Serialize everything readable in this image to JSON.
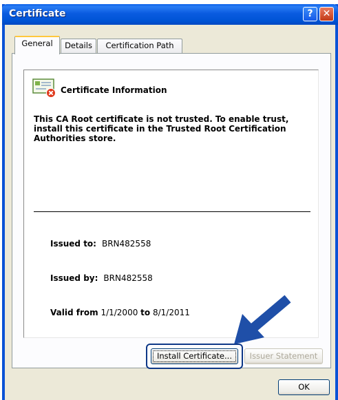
{
  "window": {
    "title": "Certificate",
    "help": "?",
    "close": "✕"
  },
  "tabs": [
    {
      "label": "General",
      "active": true
    },
    {
      "label": "Details",
      "active": false
    },
    {
      "label": "Certification Path",
      "active": false
    }
  ],
  "info": {
    "title": "Certificate Information",
    "warning": "This CA Root certificate is not trusted. To enable trust, install this certificate in the Trusted Root Certification Authorities store.",
    "issued_to_label": "Issued to:",
    "issued_to": "BRN482558",
    "issued_by_label": "Issued by:",
    "issued_by": "BRN482558",
    "valid_from_label": "Valid from",
    "valid_from": "1/1/2000",
    "to_label": "to",
    "valid_to": "8/1/2011"
  },
  "buttons": {
    "install": "Install Certificate...",
    "issuer_statement": "Issuer Statement",
    "ok": "OK"
  },
  "colors": {
    "title_bar": "#0054d6",
    "arrow": "#1f4fa8",
    "dialog_bg": "#ece9d8"
  }
}
